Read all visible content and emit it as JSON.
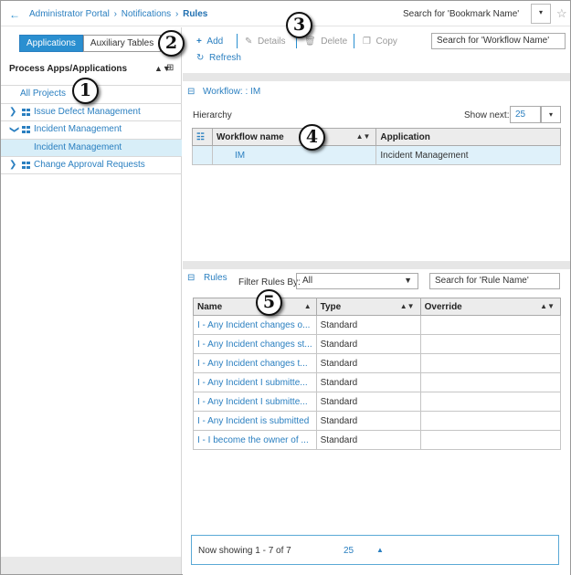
{
  "breadcrumb": {
    "items": [
      "Administrator Portal",
      "Notifications"
    ],
    "separator": "›",
    "current": "Rules"
  },
  "bookmark": {
    "search_label": "Search for 'Bookmark Name'",
    "dropdown_glyph": "▾",
    "star_glyph": "☆"
  },
  "left": {
    "tabs": [
      "Applications",
      "Auxiliary Tables"
    ],
    "header": "Process Apps/Applications",
    "tree": [
      {
        "label": "All Projects",
        "type": "link"
      },
      {
        "label": "Issue Defect Management",
        "type": "collapsed"
      },
      {
        "label": "Incident Management",
        "type": "expanded"
      },
      {
        "label": "Incident Management",
        "type": "child-selected"
      },
      {
        "label": "Change Approval Requests",
        "type": "collapsed"
      }
    ]
  },
  "toolbar": {
    "add": "Add",
    "details": "Details",
    "delete": "Delete",
    "copy": "Copy",
    "refresh": "Refresh",
    "search_placeholder": "Search for 'Workflow Name'"
  },
  "workflow": {
    "title": "Workflow: : IM",
    "hierarchy_label": "Hierarchy",
    "show_next_label": "Show next:",
    "show_next_value": "25",
    "columns": [
      "Workflow name",
      "Application"
    ],
    "rows": [
      [
        "IM",
        "Incident Management"
      ]
    ]
  },
  "rules": {
    "title": "Rules",
    "filter_label": "Filter Rules By:",
    "filter_value": "All",
    "search_placeholder": "Search for 'Rule Name'",
    "columns": [
      "Name",
      "Type",
      "Override"
    ],
    "rows": [
      [
        "I - Any Incident changes o...",
        "Standard",
        ""
      ],
      [
        "I - Any Incident changes st...",
        "Standard",
        ""
      ],
      [
        "I - Any Incident changes t...",
        "Standard",
        ""
      ],
      [
        "I - Any Incident I submitte...",
        "Standard",
        ""
      ],
      [
        "I - Any Incident I submitte...",
        "Standard",
        ""
      ],
      [
        "I - Any Incident is submitted",
        "Standard",
        ""
      ],
      [
        "I - I become the owner of ...",
        "Standard",
        ""
      ]
    ]
  },
  "footer": {
    "showing": "Now showing 1 - 7 of 7",
    "page_size": "25"
  },
  "callouts": [
    "1",
    "2",
    "3",
    "4",
    "5"
  ],
  "colors": {
    "accent": "#2a8fd0",
    "link": "#2a7fc0",
    "selection": "#d8eef8"
  }
}
